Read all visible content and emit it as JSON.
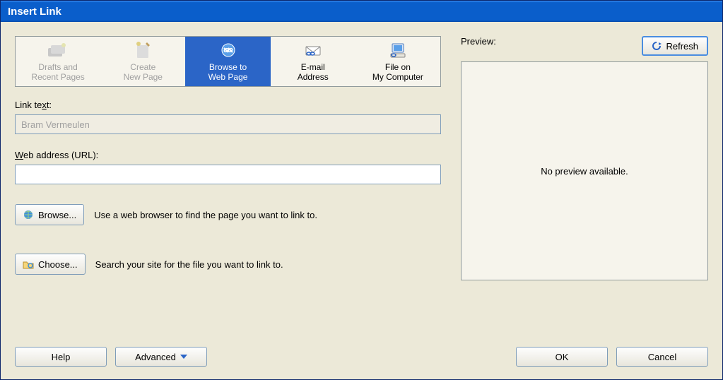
{
  "window": {
    "title": "Insert Link"
  },
  "tabs": [
    {
      "line1": "Drafts and",
      "line2": "Recent Pages"
    },
    {
      "line1": "Create",
      "line2": "New Page"
    },
    {
      "line1": "Browse to",
      "line2": "Web Page"
    },
    {
      "line1": "E-mail",
      "line2": "Address"
    },
    {
      "line1": "File on",
      "line2": "My Computer"
    }
  ],
  "link_text_label_pre": "Link te",
  "link_text_label_u": "x",
  "link_text_label_post": "t:",
  "link_text_value": "Bram Vermeulen",
  "url_label_u": "W",
  "url_label_post": "eb address (URL):",
  "url_value": "",
  "browse_btn": "Browse...",
  "browse_hint": "Use a web browser to find the page you want to link to.",
  "choose_btn": "Choose...",
  "choose_hint": "Search your site for the file you want to link to.",
  "preview_label": "Preview:",
  "refresh_btn": "Refresh",
  "preview_empty": "No preview available.",
  "buttons": {
    "help": "Help",
    "advanced": "Advanced",
    "ok": "OK",
    "cancel": "Cancel"
  }
}
